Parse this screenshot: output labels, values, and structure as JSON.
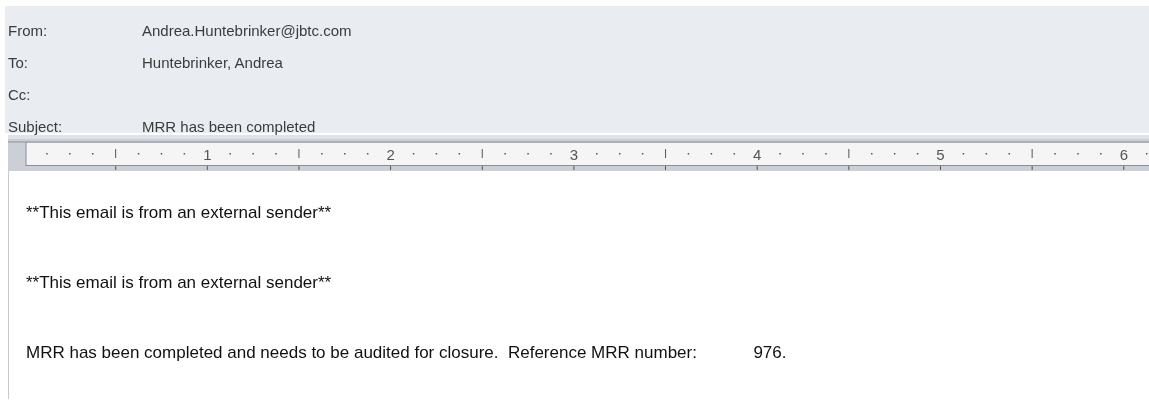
{
  "header": {
    "fields": [
      {
        "label": "From:",
        "value": "Andrea.Huntebrinker@jbtc.com"
      },
      {
        "label": "To:",
        "value": "Huntebrinker, Andrea"
      },
      {
        "label": "Cc:"
      },
      {
        "label": "Subject:",
        "value": "MRR has been completed"
      }
    ]
  },
  "ruler": {
    "labels": [
      "1",
      "2",
      "3",
      "4",
      "5",
      "6"
    ]
  },
  "body": {
    "paragraphs": [
      "**This email is from an external sender**",
      "**This email is from an external sender**",
      "MRR has been completed and needs to be audited for closure.  Reference MRR number:\t976."
    ]
  }
}
